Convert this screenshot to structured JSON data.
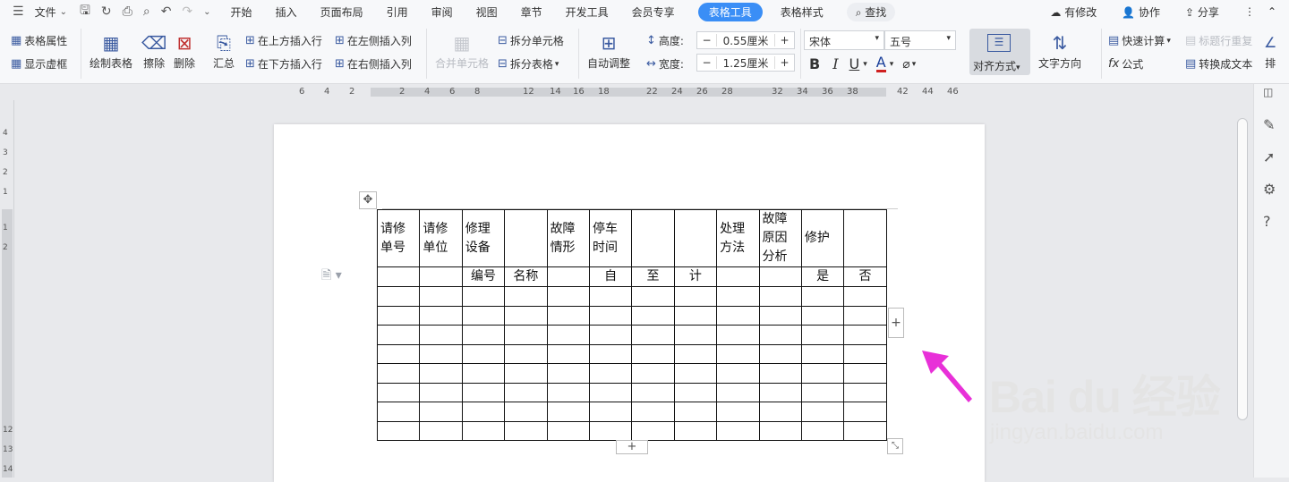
{
  "menubar": {
    "file_label": "文件",
    "tabs": [
      "开始",
      "插入",
      "页面布局",
      "引用",
      "审阅",
      "视图",
      "章节",
      "开发工具",
      "会员专享"
    ],
    "active_tab": "表格工具",
    "table_style_tab": "表格样式",
    "search_label": "查找",
    "right": {
      "changes": "有修改",
      "collab": "协作",
      "share": "分享"
    }
  },
  "ribbon": {
    "table_props": "表格属性",
    "show_gridlines": "显示虚框",
    "draw_table": "绘制表格",
    "erase": "擦除",
    "delete": "删除",
    "summary": "汇总",
    "insert_above": "在上方插入行",
    "insert_below": "在下方插入行",
    "insert_left": "在左侧插入列",
    "insert_right": "在右侧插入列",
    "merge_cells": "合并单元格",
    "split_cells": "拆分单元格",
    "split_table": "拆分表格",
    "auto_fit": "自动调整",
    "height_label": "高度:",
    "height_value": "0.55厘米",
    "width_label": "宽度:",
    "width_value": "1.25厘米",
    "font_name": "宋体",
    "font_size": "五号",
    "align": "对齐方式",
    "text_direction": "文字方向",
    "quick_calc": "快速计算",
    "formula": "公式",
    "header_repeat": "标题行重复",
    "to_text": "转换成文本",
    "sort_cut": "排"
  },
  "ruler": {
    "h_ticks": [
      "6",
      "4",
      "2",
      "2",
      "4",
      "6",
      "8",
      "12",
      "14",
      "16",
      "18",
      "22",
      "24",
      "26",
      "28",
      "32",
      "34",
      "36",
      "38",
      "42",
      "44",
      "46"
    ],
    "v_ticks": [
      "4",
      "3",
      "2",
      "1",
      "1",
      "2",
      "12",
      "13",
      "14"
    ]
  },
  "table": {
    "header_row1": [
      "请修单号",
      "请修单位",
      "修理设备",
      "",
      "故障情形",
      "停车时间",
      "",
      "",
      "处理方法",
      "故障原因分析",
      "修护",
      ""
    ],
    "header_row2": [
      "",
      "",
      "编号",
      "名称",
      "",
      "自",
      "至",
      "计",
      "",
      "",
      "是",
      "否"
    ],
    "empty_rows": 8,
    "columns": 12
  },
  "watermark": {
    "brand": "Bai du 经验",
    "url": "jingyan.baidu.com"
  },
  "colors": {
    "accent": "#3a8ef6",
    "arrow": "#e830d8"
  }
}
